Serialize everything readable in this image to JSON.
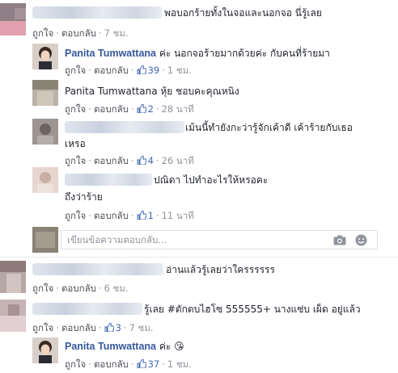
{
  "actions": {
    "like": "ถูกใจ",
    "reply": "ตอบกลับ",
    "separator": "·"
  },
  "comments": [
    {
      "text": "พอบอกร้ายทั้งในจอและนอกจอ นี่รู้เลย",
      "likes": "",
      "time": "7 ชม."
    },
    {
      "author": "Panita Tumwattana",
      "text": "ค่ะ นอกจอร้ายมากด้วยค่ะ กับคนที่ร้ายมา",
      "likes": "39",
      "time": "1 ชม."
    },
    {
      "text": "Panita Tumwattana หุ้ย ชอบคะคุณหนิง",
      "likes": "2",
      "time": "28 นาที"
    },
    {
      "text_line1": "เม้นนี้ทำยังกะว่ารู้จักเค้าดี เค้าร้ายกับเธอ",
      "text_line2": "เหรอ",
      "likes": "4",
      "time": "26 นาที"
    },
    {
      "text_line1": "ปณิดา ไปทำอะไรให้หรอคะ",
      "text_line2": "ถึงว่าร้าย",
      "likes": "1",
      "time": "11 นาที"
    },
    {
      "text": "อ่านแล้วรู้เลยว่าใครรรรรร",
      "likes": "",
      "time": "6 ชม."
    },
    {
      "text": "รู้เลย #ตักตบไฮโซ 555555+ นางแซ่บ เผ็ด อยู่แล้ว",
      "likes": "3",
      "time": "7 ชม."
    },
    {
      "author": "Panita Tumwattana",
      "text": "ค่ะ",
      "emoji": "😘",
      "likes": "37",
      "time": "1 ชม."
    }
  ],
  "reply_box": {
    "placeholder": "เขียนข้อความตอบกลับ..."
  },
  "icons": {
    "like": "thumbs-up-icon",
    "camera": "camera-icon",
    "emoji": "smiley-icon"
  },
  "colors": {
    "link": "#365899",
    "meta": "#90949c",
    "like": "#4267b2"
  }
}
